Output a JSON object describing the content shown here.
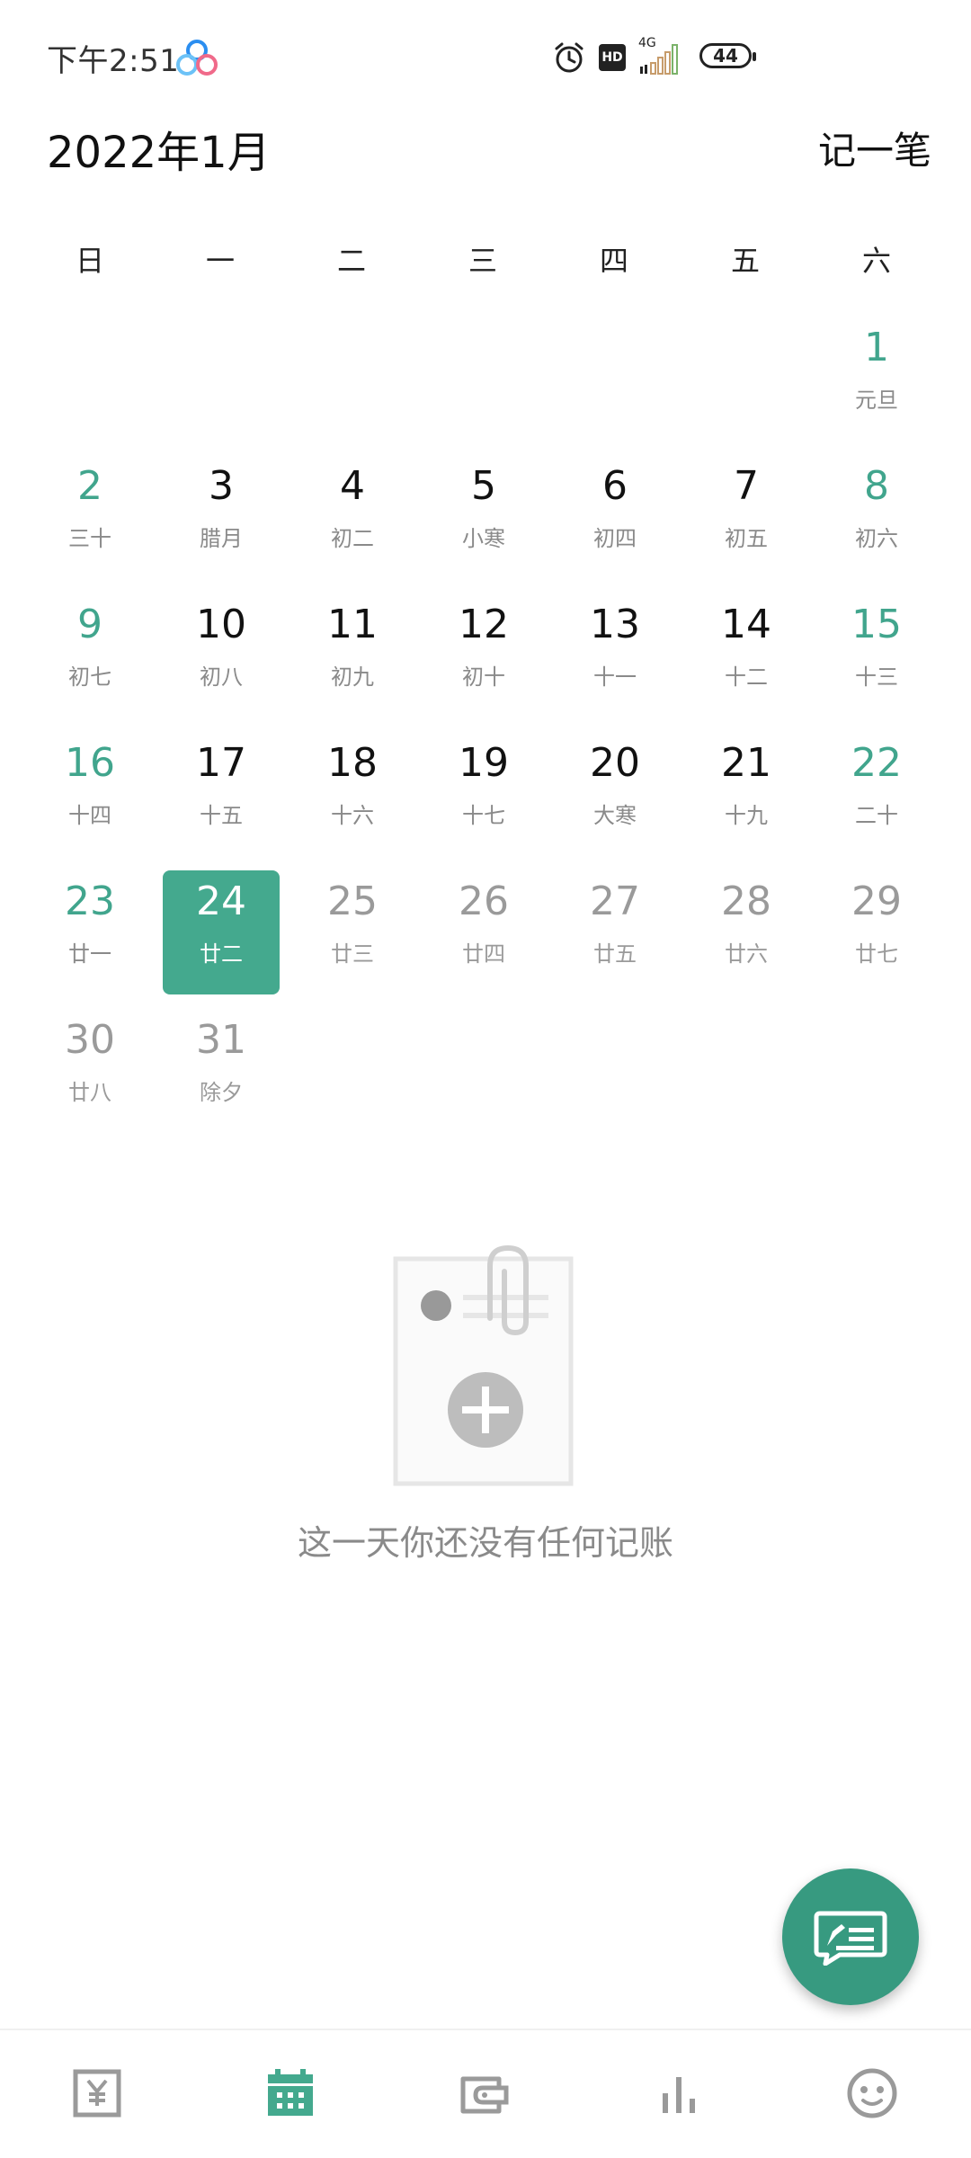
{
  "status_bar": {
    "time": "下午2:51",
    "network_label": "4G",
    "hd_label": "HD",
    "battery": "44"
  },
  "header": {
    "title": "2022年1月",
    "action_label": "记一笔"
  },
  "weekdays": [
    "日",
    "一",
    "二",
    "三",
    "四",
    "五",
    "六"
  ],
  "calendar": {
    "days": [
      {
        "day": "1",
        "lunar": "元旦"
      },
      {
        "day": "2",
        "lunar": "三十"
      },
      {
        "day": "3",
        "lunar": "腊月"
      },
      {
        "day": "4",
        "lunar": "初二"
      },
      {
        "day": "5",
        "lunar": "小寒"
      },
      {
        "day": "6",
        "lunar": "初四"
      },
      {
        "day": "7",
        "lunar": "初五"
      },
      {
        "day": "8",
        "lunar": "初六"
      },
      {
        "day": "9",
        "lunar": "初七"
      },
      {
        "day": "10",
        "lunar": "初八"
      },
      {
        "day": "11",
        "lunar": "初九"
      },
      {
        "day": "12",
        "lunar": "初十"
      },
      {
        "day": "13",
        "lunar": "十一"
      },
      {
        "day": "14",
        "lunar": "十二"
      },
      {
        "day": "15",
        "lunar": "十三"
      },
      {
        "day": "16",
        "lunar": "十四"
      },
      {
        "day": "17",
        "lunar": "十五"
      },
      {
        "day": "18",
        "lunar": "十六"
      },
      {
        "day": "19",
        "lunar": "十七"
      },
      {
        "day": "20",
        "lunar": "大寒"
      },
      {
        "day": "21",
        "lunar": "十九"
      },
      {
        "day": "22",
        "lunar": "二十"
      },
      {
        "day": "23",
        "lunar": "廿一"
      },
      {
        "day": "24",
        "lunar": "廿二"
      },
      {
        "day": "25",
        "lunar": "廿三"
      },
      {
        "day": "26",
        "lunar": "廿四"
      },
      {
        "day": "27",
        "lunar": "廿五"
      },
      {
        "day": "28",
        "lunar": "廿六"
      },
      {
        "day": "29",
        "lunar": "廿七"
      },
      {
        "day": "30",
        "lunar": "廿八"
      },
      {
        "day": "31",
        "lunar": "除夕"
      }
    ],
    "selected_day": "24"
  },
  "empty_state": {
    "message": "这一天你还没有任何记账",
    "icon": "empty-note-plus-icon"
  },
  "fab": {
    "icon": "write-record-icon"
  },
  "bottom_nav": [
    {
      "icon": "yen-icon",
      "active": false
    },
    {
      "icon": "calendar-icon",
      "active": true
    },
    {
      "icon": "wallet-icon",
      "active": false
    },
    {
      "icon": "bar-chart-icon",
      "active": false
    },
    {
      "icon": "smiley-icon",
      "active": false
    }
  ],
  "colors": {
    "accent": "#44a98e",
    "weekend": "#41a58d",
    "muted": "#9a9a9a"
  }
}
